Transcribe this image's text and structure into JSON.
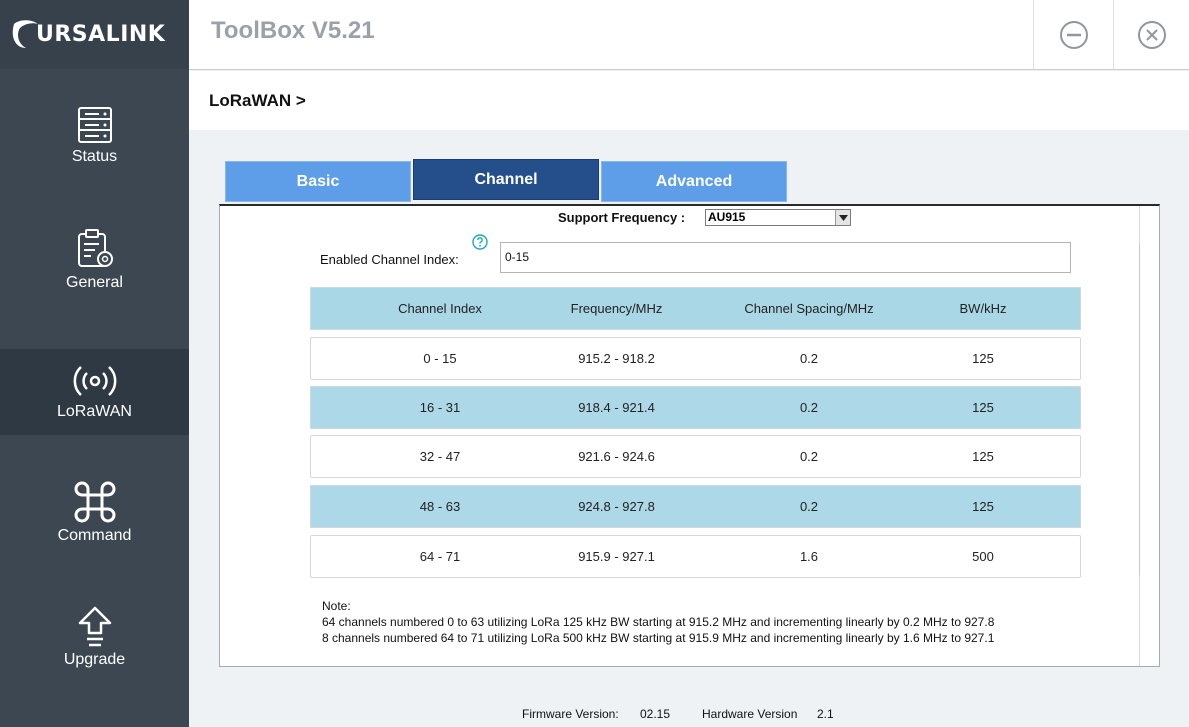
{
  "brand": {
    "logo_text": "URSALINK"
  },
  "header": {
    "title": "ToolBox V5.21"
  },
  "sidebar": {
    "items": [
      {
        "label": "Status",
        "icon": "status-icon"
      },
      {
        "label": "General",
        "icon": "general-icon"
      },
      {
        "label": "LoRaWAN",
        "icon": "lorawan-icon",
        "active": true
      },
      {
        "label": "Command",
        "icon": "command-icon"
      },
      {
        "label": "Upgrade",
        "icon": "upgrade-icon"
      }
    ]
  },
  "breadcrumb": "LoRaWAN >",
  "tabs": [
    {
      "label": "Basic"
    },
    {
      "label": "Channel",
      "active": true
    },
    {
      "label": "Advanced"
    }
  ],
  "channel": {
    "support_frequency_label": "Support Frequency :",
    "support_frequency_value": "AU915",
    "enabled_index_label": "Enabled Channel Index:",
    "enabled_index_value": "0-15",
    "table": {
      "headers": [
        "Channel Index",
        "Frequency/MHz",
        "Channel Spacing/MHz",
        "BW/kHz"
      ],
      "rows": [
        [
          "0 - 15",
          "915.2 - 918.2",
          "0.2",
          "125"
        ],
        [
          "16 - 31",
          "918.4 - 921.4",
          "0.2",
          "125"
        ],
        [
          "32 - 47",
          "921.6 - 924.6",
          "0.2",
          "125"
        ],
        [
          "48 - 63",
          "924.8 - 927.8",
          "0.2",
          "125"
        ],
        [
          "64 - 71",
          "915.9 - 927.1",
          "1.6",
          "500"
        ]
      ]
    },
    "note": {
      "title": "Note:",
      "line1": "64 channels numbered 0 to 63 utilizing LoRa 125 kHz BW starting at 915.2 MHz and incrementing linearly by 0.2 MHz to 927.8",
      "line2": "8 channels numbered 64 to 71 utilizing LoRa 500 kHz BW starting at 915.9 MHz and incrementing linearly by 1.6 MHz to 927.1"
    }
  },
  "footer": {
    "firmware_label": "Firmware Version:",
    "firmware_value": "02.15",
    "hardware_label": "Hardware Version",
    "hardware_value": "2.1"
  },
  "colors": {
    "sidebar": "#3c4752",
    "sidebar_active": "#2e3943",
    "tab": "#5e9ee9",
    "tab_active": "#244f8a",
    "table_highlight": "#acd8e7"
  }
}
